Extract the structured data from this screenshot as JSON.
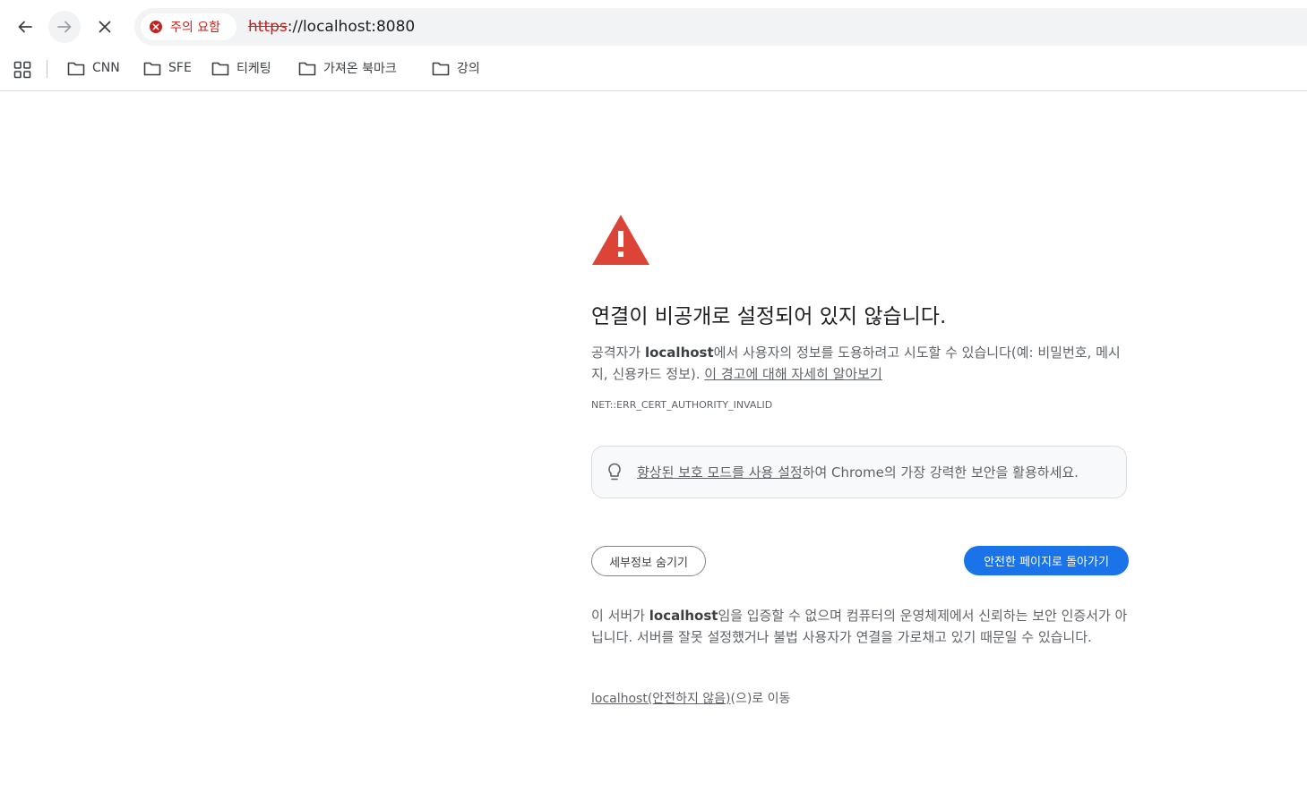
{
  "browser": {
    "security_chip": "주의 요함",
    "url_scheme": "https",
    "url_rest": "://localhost:8080",
    "colors": {
      "danger": "#c5221f",
      "accent": "#1a73e8"
    }
  },
  "bookmarks": [
    {
      "label": "CNN",
      "icon": "folder-icon"
    },
    {
      "label": "SFE",
      "icon": "folder-icon"
    },
    {
      "label": "티케팅",
      "icon": "folder-icon"
    },
    {
      "label": "가져온 북마크",
      "icon": "folder-icon"
    },
    {
      "label": "강의",
      "icon": "folder-icon"
    }
  ],
  "interstitial": {
    "title": "연결이 비공개로 설정되어 있지 않습니다.",
    "desc_pre": "공격자가 ",
    "desc_host": "localhost",
    "desc_post": "에서 사용자의 정보를 도용하려고 시도할 수 있습니다(예: 비밀번호, 메시지, 신용카드 정보). ",
    "learn_more": "이 경고에 대해 자세히 알아보기",
    "error_code": "NET::ERR_CERT_AUTHORITY_INVALID",
    "promo_link": "향상된 보호 모드를 사용 설정",
    "promo_text": "하여 Chrome의 가장 강력한 보안을 활용하세요.",
    "hide_details": "세부정보 숨기기",
    "back_to_safety": "안전한 페이지로 돌아가기",
    "detail_pre": "이 서버가 ",
    "detail_host": "localhost",
    "detail_post": "임을 입증할 수 없으며 컴퓨터의 운영체제에서 신뢰하는 보안 인증서가 아닙니다. 서버를 잘못 설정했거나 불법 사용자가 연결을 가로채고 있기 때문일 수 있습니다.",
    "proceed_link": "localhost(안전하지 않음)",
    "proceed_suffix": "(으)로 이동"
  }
}
